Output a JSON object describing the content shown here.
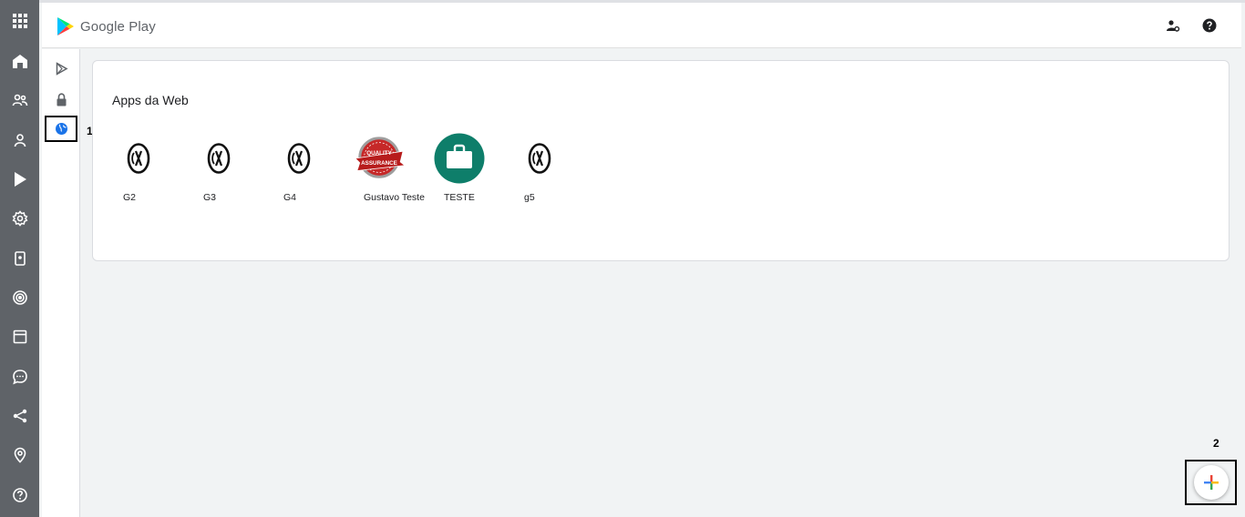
{
  "header": {
    "brand": "Google Play",
    "brand_color": "#5f6368"
  },
  "left_rail": {
    "background": "#5f6368",
    "items": [
      {
        "icon": "apps-grid-icon"
      },
      {
        "icon": "home-icon"
      },
      {
        "icon": "groups-icon"
      },
      {
        "icon": "person-icon"
      },
      {
        "icon": "play-icon"
      },
      {
        "icon": "settings-icon"
      },
      {
        "icon": "device-icon"
      },
      {
        "icon": "target-icon"
      },
      {
        "icon": "window-icon"
      },
      {
        "icon": "chat-icon"
      },
      {
        "icon": "share-icon"
      },
      {
        "icon": "location-icon"
      },
      {
        "icon": "help-icon"
      }
    ]
  },
  "sub_rail": {
    "items": [
      {
        "icon": "play-outline-icon"
      },
      {
        "icon": "lock-icon"
      },
      {
        "icon": "globe-icon",
        "selected": true
      }
    ]
  },
  "callouts": {
    "one": "1",
    "two": "2"
  },
  "card": {
    "title": "Apps da Web",
    "apps": [
      {
        "name": "G2",
        "icon": "gx-logo-icon"
      },
      {
        "name": "G3",
        "icon": "gx-logo-icon"
      },
      {
        "name": "G4",
        "icon": "gx-logo-icon"
      },
      {
        "name": "Gustavo Teste",
        "icon": "quality-assurance-badge-icon"
      },
      {
        "name": "TESTE",
        "icon": "briefcase-icon"
      },
      {
        "name": "g5",
        "icon": "gx-logo-icon"
      }
    ]
  },
  "colors": {
    "teste_icon_bg": "#0e7e6a",
    "badge_red": "#c62828",
    "globe_blue": "#1a73e8"
  }
}
